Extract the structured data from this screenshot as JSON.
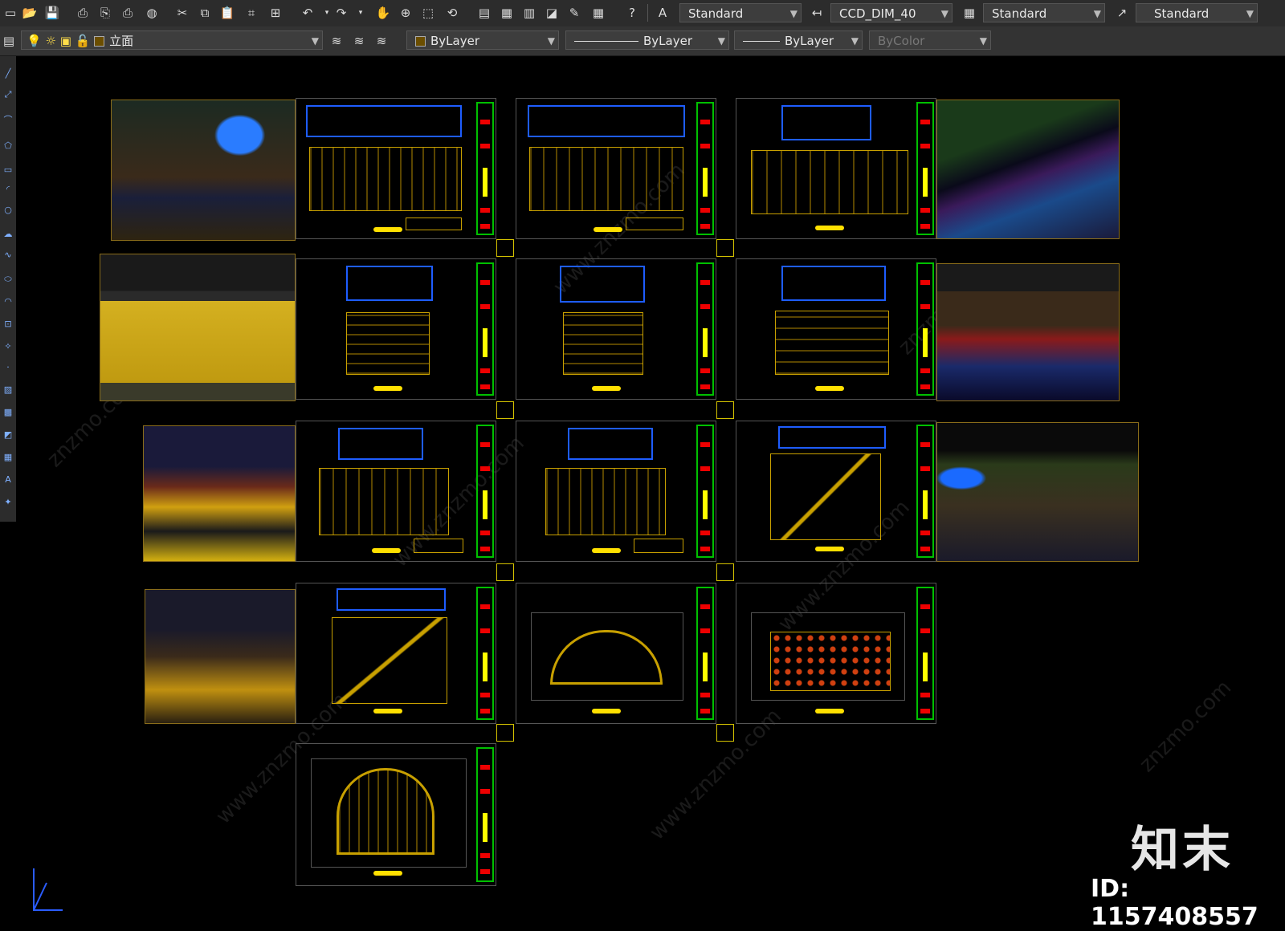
{
  "toolbar": {
    "text_style": "Standard",
    "dim_style": "CCD_DIM_40",
    "table_style": "Standard",
    "multileader_style": "Standard"
  },
  "layer_bar": {
    "layer_name": "立面",
    "color": "ByLayer",
    "linetype": "ByLayer",
    "lineweight": "ByLayer",
    "plot_style": "ByColor"
  },
  "watermark": {
    "logo_text": "知末",
    "image_id": "ID: 1157408557"
  },
  "colors": {
    "canvas": "#000000",
    "title_block": "#00c000",
    "plan_frame": "#1e5dff",
    "drawing_lines": "#c8a000",
    "highlight": "#ffff00"
  }
}
